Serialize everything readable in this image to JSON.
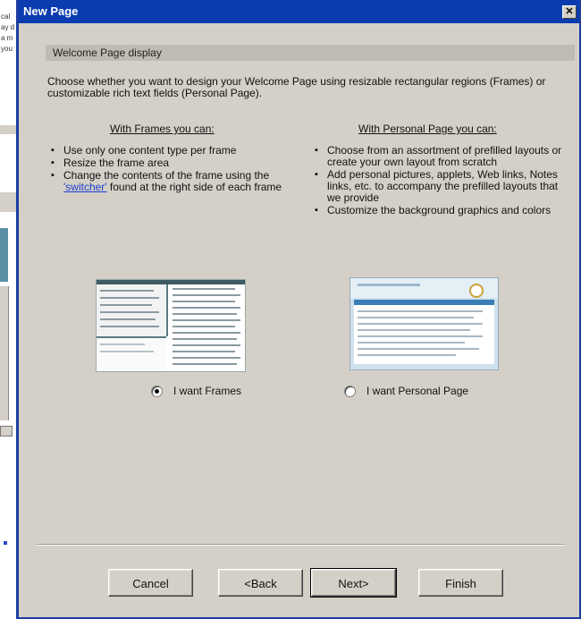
{
  "background_app": {
    "text_lines": [
      "cal",
      "ay d",
      "a m",
      "you"
    ]
  },
  "window": {
    "title": "New Page",
    "close_glyph": "✕"
  },
  "section": {
    "header": "Welcome Page display",
    "intro": "Choose whether you want to design your Welcome Page using resizable rectangular regions (Frames) or customizable rich text fields (Personal Page)."
  },
  "frames": {
    "heading": "With Frames you can:",
    "bullets": [
      "Use only one content type per frame",
      "Resize the frame area",
      "Change the contents of the frame using the"
    ],
    "bullet3_link": "'switcher'",
    "bullet3_tail": " found at the right side of each frame",
    "radio_label": "I want Frames",
    "selected": true
  },
  "personal": {
    "heading": "With Personal Page you can:",
    "bullets": [
      "Choose from an assortment of prefilled layouts or create your own layout from scratch",
      "Add personal pictures, applets, Web links, Notes links, etc. to accompany the prefilled layouts that we provide",
      "Customize the background graphics and colors"
    ],
    "radio_label": "I want Personal Page",
    "selected": false
  },
  "buttons": {
    "cancel": "Cancel",
    "back": "<Back",
    "next": "Next>",
    "finish": "Finish"
  },
  "colors": {
    "titlebar": "#0a3cb0",
    "dialog_bg": "#d4d0c8",
    "link": "#1a3dcc"
  }
}
